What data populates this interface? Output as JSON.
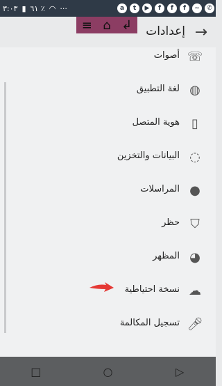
{
  "status_bar": {
    "time": "٣:٠٣",
    "battery_text": "٦١ ٪",
    "icons": [
      "whatsapp-icon",
      "messenger-icon",
      "facebook-icon",
      "facebook-icon",
      "facebook-icon",
      "youtube-icon",
      "twitter-icon",
      "amazon-icon",
      "more-icon",
      "wifi-icon",
      "battery-icon"
    ]
  },
  "overlay_toolbar": {
    "icons": [
      "menu-icon",
      "home-icon",
      "return-icon"
    ]
  },
  "header": {
    "title": "إعدادات"
  },
  "settings": {
    "items": [
      {
        "label": "أصوات",
        "icon": "phone-volume-icon"
      },
      {
        "label": "لغة التطبيق",
        "icon": "globe-icon"
      },
      {
        "label": "هوية المتصل",
        "icon": "phone-device-icon"
      },
      {
        "label": "البيانات والتخزين",
        "icon": "data-usage-icon"
      },
      {
        "label": "المراسلات",
        "icon": "chat-bubble-icon"
      },
      {
        "label": "حظر",
        "icon": "shield-check-icon"
      },
      {
        "label": "المظهر",
        "icon": "palette-icon"
      },
      {
        "label": "نسخة احتياطية",
        "icon": "cloud-check-icon"
      },
      {
        "label": "تسجيل المكالمة",
        "icon": "microphone-icon"
      }
    ]
  },
  "nav_bar": {
    "icons": [
      "recent-apps-icon",
      "home-circle-icon",
      "back-triangle-icon"
    ]
  },
  "colors": {
    "status_bar": "#2f3a47",
    "overlay_toolbar": "#8c3d63",
    "annotation_arrow": "#e53935",
    "nav_bar": "#5c5e60"
  }
}
